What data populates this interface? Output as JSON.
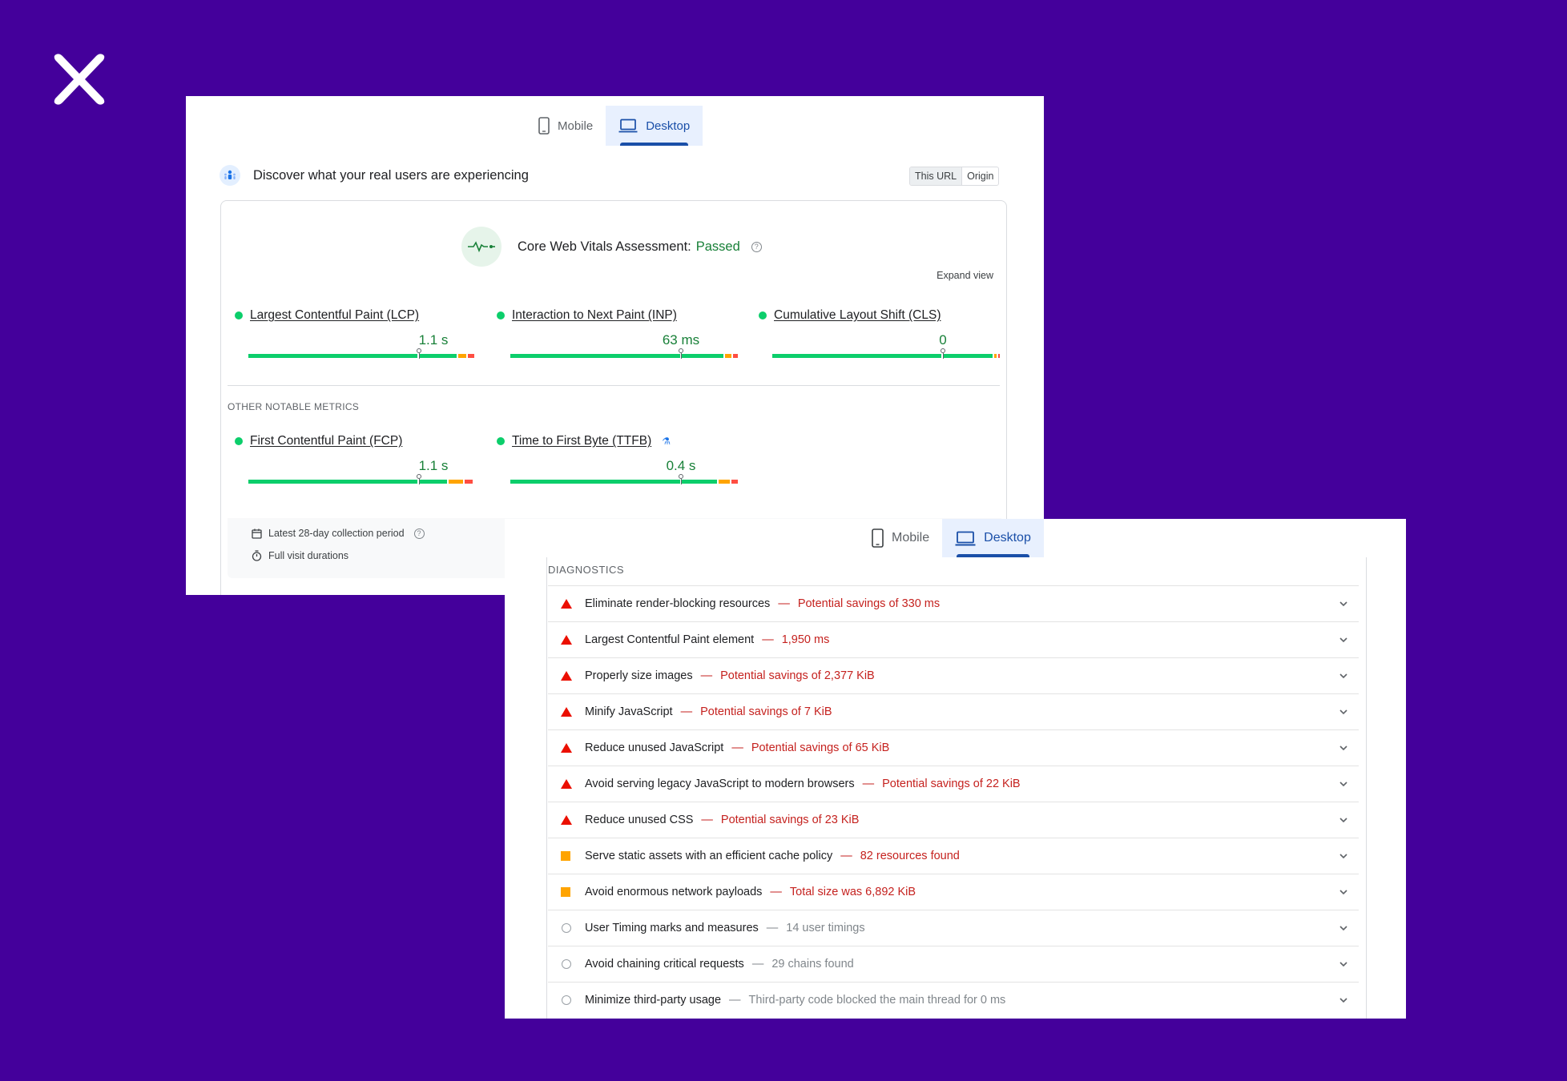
{
  "brand": {
    "logo_icon": "x-logo-icon",
    "bg_color": "#44009b"
  },
  "panel1": {
    "tabs": [
      {
        "label": "Mobile",
        "icon": "phone-icon",
        "active": false
      },
      {
        "label": "Desktop",
        "icon": "laptop-icon",
        "active": true
      }
    ],
    "discover_text": "Discover what your real users are experiencing",
    "segments": [
      "This URL",
      "Origin"
    ],
    "assessment": {
      "label": "Core Web Vitals Assessment:",
      "status": "Passed"
    },
    "expand_view": "Expand view",
    "core_metrics": [
      {
        "label": "Largest Contentful Paint (LCP)",
        "value": "1.1 s"
      },
      {
        "label": "Interaction to Next Paint (INP)",
        "value": "63 ms"
      },
      {
        "label": "Cumulative Layout Shift (CLS)",
        "value": "0"
      }
    ],
    "other_heading": "OTHER NOTABLE METRICS",
    "other_metrics": [
      {
        "label": "First Contentful Paint (FCP)",
        "value": "1.1 s"
      },
      {
        "label": "Time to First Byte (TTFB)",
        "value": "0.4 s",
        "badge_icon": "flask-icon"
      }
    ],
    "footer": [
      {
        "icon": "calendar-icon",
        "text": "Latest 28-day collection period"
      },
      {
        "icon": "stopwatch-icon",
        "text": "Full visit durations"
      }
    ]
  },
  "panel2": {
    "tabs": [
      {
        "label": "Mobile",
        "icon": "phone-icon",
        "active": false
      },
      {
        "label": "Desktop",
        "icon": "laptop-icon",
        "active": true
      }
    ],
    "section_title": "DIAGNOSTICS",
    "items": [
      {
        "severity": "fail",
        "title": "Eliminate render-blocking resources",
        "detail": "Potential savings of 330 ms"
      },
      {
        "severity": "fail",
        "title": "Largest Contentful Paint element",
        "detail": "1,950 ms"
      },
      {
        "severity": "fail",
        "title": "Properly size images",
        "detail": "Potential savings of 2,377 KiB"
      },
      {
        "severity": "fail",
        "title": "Minify JavaScript",
        "detail": "Potential savings of 7 KiB"
      },
      {
        "severity": "fail",
        "title": "Reduce unused JavaScript",
        "detail": "Potential savings of 65 KiB"
      },
      {
        "severity": "fail",
        "title": "Avoid serving legacy JavaScript to modern browsers",
        "detail": "Potential savings of 22 KiB"
      },
      {
        "severity": "fail",
        "title": "Reduce unused CSS",
        "detail": "Potential savings of 23 KiB"
      },
      {
        "severity": "average",
        "title": "Serve static assets with an efficient cache policy",
        "detail": "82 resources found"
      },
      {
        "severity": "average",
        "title": "Avoid enormous network payloads",
        "detail": "Total size was 6,892 KiB"
      },
      {
        "severity": "info",
        "title": "User Timing marks and measures",
        "detail": "14 user timings"
      },
      {
        "severity": "info",
        "title": "Avoid chaining critical requests",
        "detail": "29 chains found"
      },
      {
        "severity": "info",
        "title": "Minimize third-party usage",
        "detail": "Third-party code blocked the main thread for 0 ms"
      }
    ]
  }
}
